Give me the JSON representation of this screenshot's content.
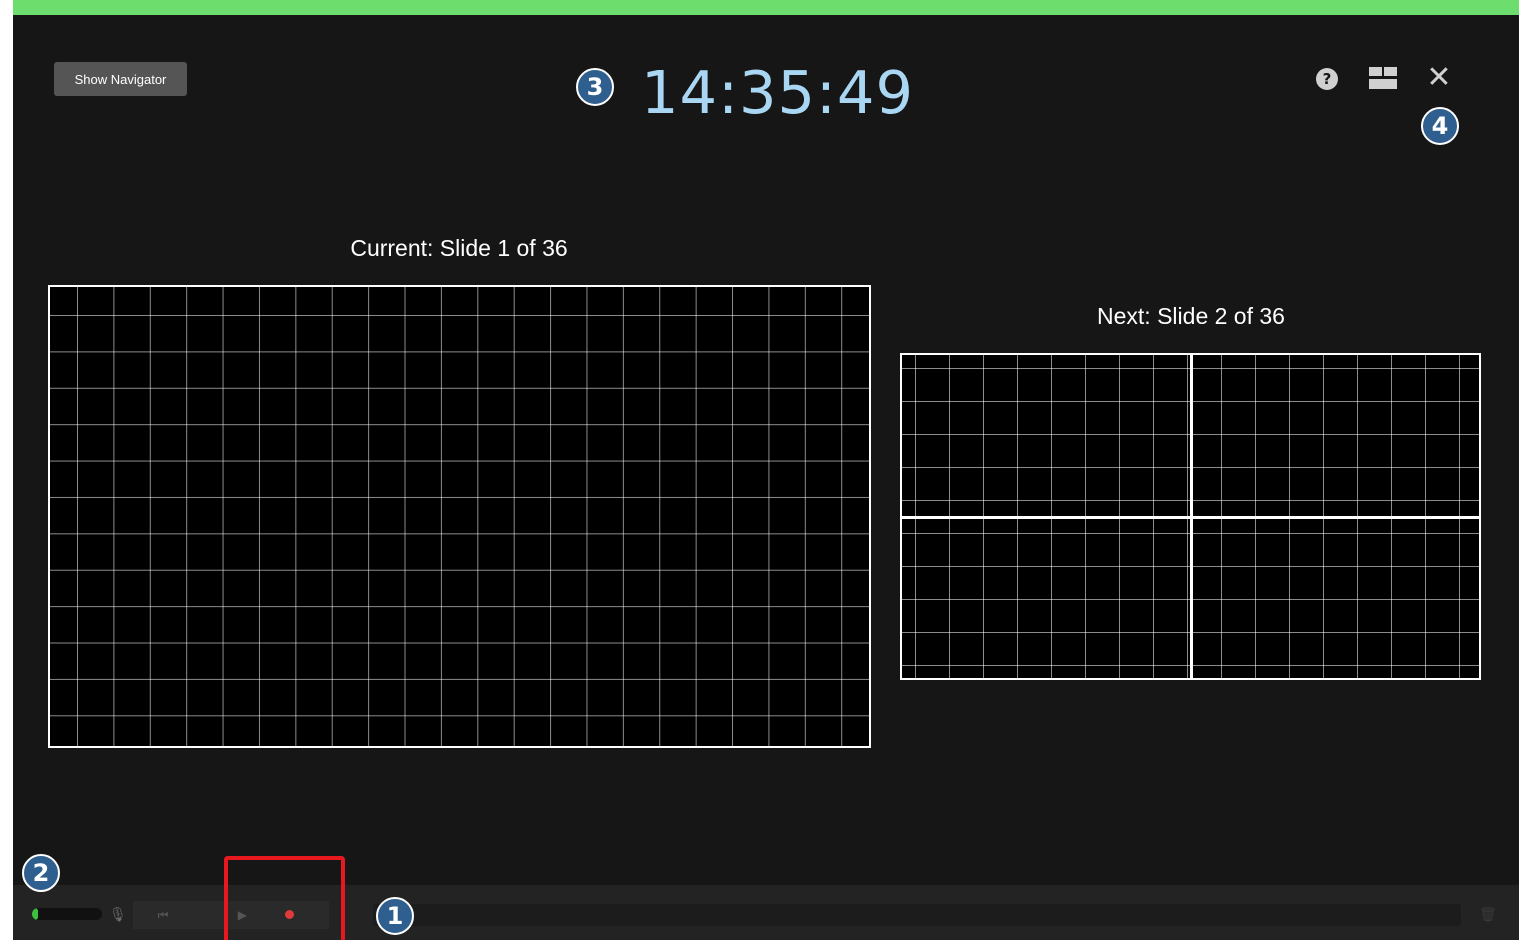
{
  "window": {
    "accent_color": "#6ddd6e",
    "background_color": "#161616"
  },
  "header": {
    "show_navigator_label": "Show Navigator",
    "clock": "14:35:49",
    "help_icon": "question-circle-icon",
    "help_glyph": "?",
    "layout_icon": "layout-grid-icon",
    "close_icon": "close-icon",
    "close_glyph": "✕"
  },
  "slides": {
    "current_label": "Current: Slide 1 of 36",
    "next_label": "Next: Slide 2 of 36"
  },
  "controls": {
    "audio_level": 0.08,
    "mic_icon": "mic-muted-icon",
    "mic_glyph": "🎙",
    "prev_icon": "skip-back-icon",
    "prev_glyph": "⏮",
    "play_icon": "play-icon",
    "play_glyph": "▶",
    "record_icon": "record-dot-icon",
    "record_color": "#e03a3a",
    "trash_icon": "trash-icon",
    "trash_glyph": "🗑"
  },
  "annotations": {
    "badge_1": "1",
    "badge_2": "2",
    "badge_3": "3",
    "badge_4": "4",
    "badge_color": "#2f5f8e",
    "highlight_color": "#e8181f"
  }
}
